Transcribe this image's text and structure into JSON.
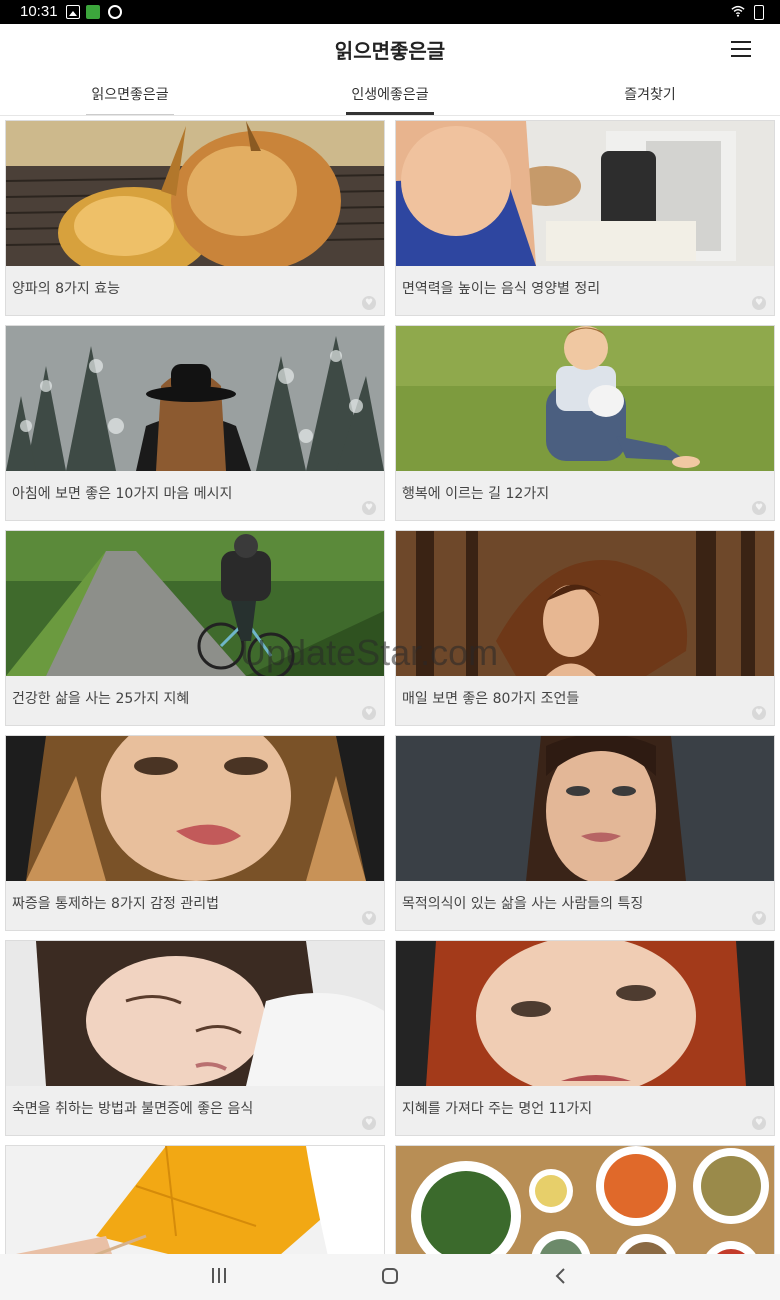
{
  "status_bar": {
    "time": "10:31",
    "icons": [
      "gallery-icon",
      "sheet-icon",
      "c-app-icon",
      "wifi-icon",
      "battery-icon"
    ]
  },
  "app": {
    "title": "읽으면좋은글"
  },
  "tabs": [
    {
      "label": "읽으면좋은글",
      "selected": false
    },
    {
      "label": "인생에좋은글",
      "selected": true
    },
    {
      "label": "즐겨찾기",
      "selected": false
    }
  ],
  "cards": [
    {
      "title": "양파의 8가지 효능",
      "image": "onions"
    },
    {
      "title": "면역력을 높이는 음식 영양별 정리",
      "image": "kitchen-woman"
    },
    {
      "title": "아침에 보면 좋은 10가지 마음 메시지",
      "image": "woman-hat-snow-forest"
    },
    {
      "title": "행복에 이르는 길 12가지",
      "image": "laughing-child-grass"
    },
    {
      "title": "건강한 삶을 사는 25가지 지혜",
      "image": "cyclist-path"
    },
    {
      "title": "매일 보면 좋은 80가지 조언들",
      "image": "woman-hair-forest"
    },
    {
      "title": "짜증을 통제하는 8가지 감정 관리법",
      "image": "woman-portrait-dark"
    },
    {
      "title": "목적의식이 있는 삶을 사는 사람들의 특징",
      "image": "woman-portrait-grey"
    },
    {
      "title": "숙면을 취하는 방법과 불면증에 좋은 음식",
      "image": "sleeping-girl"
    },
    {
      "title": "지혜를 가져다 주는 명언 11가지",
      "image": "redhead-woman"
    },
    {
      "title": "",
      "image": "yellow-leaf"
    },
    {
      "title": "",
      "image": "korean-food"
    }
  ],
  "watermark": "UpdateStar.com",
  "colors": {
    "card_bg": "#efefef",
    "tab_indicator": "#333333",
    "status_bar": "#000000"
  }
}
